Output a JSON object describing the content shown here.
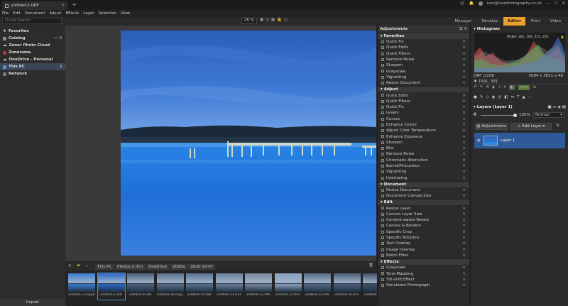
{
  "titlebar": {
    "tab_title": "untitled-2.ORF",
    "account": "ivor@ivorphotography.co.uk",
    "new_tab": "+"
  },
  "menu": [
    "File",
    "Edit",
    "Document",
    "Adjust",
    "Effects",
    "Layer",
    "Selection",
    "View"
  ],
  "toolbar": {
    "search_placeholder": "Quick Search",
    "zoom": "25 %"
  },
  "modes": [
    "Manager",
    "Develop",
    "Editor",
    "Print",
    "Video"
  ],
  "active_mode": "Editor",
  "left_nav": [
    "Favorites",
    "Catalog",
    "Zoner Photo Cloud",
    "Zonerama",
    "OneDrive - Personal",
    "This PC",
    "Network"
  ],
  "left_nav_selected": "This PC",
  "import_label": "Import",
  "breadcrumbs": [
    "This PC",
    "Photos 2 (D:)",
    "OneDrive",
    "2020a",
    "2020-10-07"
  ],
  "thumbnails": [
    {
      "caption": "untitled-2-copy.tif",
      "tone": "#3a7ad0"
    },
    {
      "caption": "untitled-2.ORF",
      "tone": "#2b66c8"
    },
    {
      "caption": "untitled-9.ORF",
      "tone": "#4d5f7a"
    },
    {
      "caption": "untitled-10-copy...",
      "tone": "#5a6e88"
    },
    {
      "caption": "untitled-10.ORF",
      "tone": "#59708c"
    },
    {
      "caption": "untitled-11.ORF",
      "tone": "#6a7f99"
    },
    {
      "caption": "untitled-12.ORF",
      "tone": "#7a879c"
    },
    {
      "caption": "untitled-13.ORF",
      "tone": "#8aa0be"
    },
    {
      "caption": "untitled-14.ORF",
      "tone": "#556982"
    },
    {
      "caption": "untitled-16.ORF",
      "tone": "#4a5c74"
    },
    {
      "caption": "untitled-17.ORF",
      "tone": "#3e4f66"
    }
  ],
  "adjustments": {
    "header": "Adjustments",
    "sections": [
      {
        "title": "Favorites",
        "items": [
          "Quick Fix",
          "Quick Edits",
          "Quick Filters",
          "Remove Noise",
          "Sharpen",
          "Grayscale",
          "Vignetting",
          "Resize Document"
        ]
      },
      {
        "title": "Adjust",
        "items": [
          "Quick Edits",
          "Quick Filters",
          "Quick Fix",
          "Levels",
          "Curves",
          "Enhance Colors",
          "Adjust Color Temperature",
          "Enhance Exposure",
          "Sharpen",
          "Blur",
          "Remove Noise",
          "Chromatic Aberration",
          "Barrel/Pincushion",
          "Vignetting",
          "Interlacing"
        ]
      },
      {
        "title": "Document",
        "items": [
          "Resize Document",
          "Document Canvas Size"
        ]
      },
      {
        "title": "Edit",
        "items": [
          "Resize Layer",
          "Canvas Layer Size",
          "Content-aware Resize",
          "Canvas & Borders",
          "Specific Crop",
          "Specific Rotation",
          "Text Overlay",
          "Image Overlay",
          "Batch Filter"
        ]
      },
      {
        "title": "Effects",
        "items": [
          "Grayscale",
          "Tone Mapping",
          "Tilt-shift Effect",
          "Simulated Photograph"
        ]
      }
    ]
  },
  "histogram": {
    "title": "Histogram",
    "rgba": "RGBA: 162, 185, 255, 255",
    "format": "ORF (2/29)",
    "dimensions": "5094 x 3821 x 48",
    "coords": "1591, 391"
  },
  "layers": {
    "title": "Layers (Layer 1)",
    "opacity": "100%",
    "blend": "Normal",
    "adjustments_btn": "Adjustments",
    "add_layer_btn": "Add Layer",
    "layer_name": "Layer 1"
  },
  "colors": {
    "accent": "#e8a12c",
    "selection": "#2f5a9a"
  }
}
